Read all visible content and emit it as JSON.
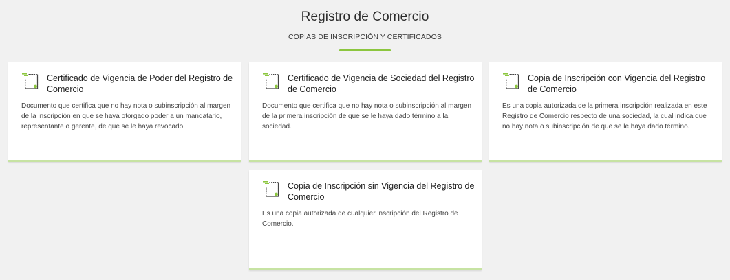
{
  "header": {
    "title": "Registro de Comercio",
    "subtitle": "COPIAS DE INSCRIPCIÓN Y CERTIFICADOS"
  },
  "colors": {
    "accent": "#8cc63f",
    "card_bottom_border": "#c7e3a3",
    "background": "#f1f1f1"
  },
  "cards": [
    {
      "icon": "document-icon",
      "title": "Certificado de Vigencia de Poder del Registro de Comercio",
      "description": "Documento que certifica que no hay nota o subinscripción al margen de la inscripción en que se haya otorgado poder a un mandatario, representante o gerente, de que se le haya revocado."
    },
    {
      "icon": "document-icon",
      "title": "Certificado de Vigencia de Sociedad del Registro de Comercio",
      "description": "Documento que certifica que no hay nota o subinscripción al margen de la primera inscripción de que se le haya dado término a la sociedad."
    },
    {
      "icon": "document-icon",
      "title": "Copia de Inscripción con Vigencia del Registro de Comercio",
      "description": "Es una copia autorizada de la primera inscripción realizada en este Registro de Comercio respecto de una sociedad, la cual indica que no hay nota o subinscripción de que se le haya dado término."
    },
    {
      "icon": "document-icon",
      "title": "Copia de Inscripción sin Vigencia del Registro de Comercio",
      "description": "Es una copia autorizada de cualquier inscripción del Registro de Comercio."
    }
  ]
}
